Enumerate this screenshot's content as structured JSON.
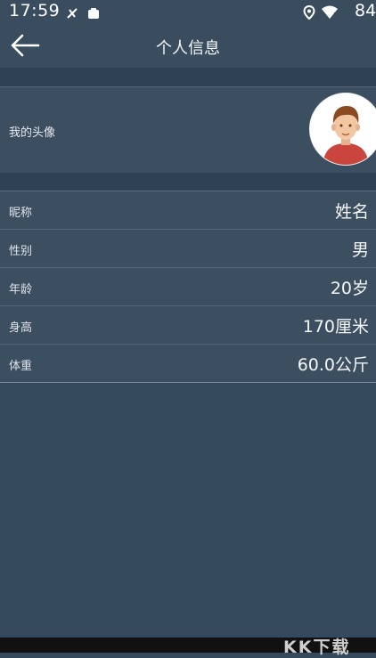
{
  "status_bar": {
    "time": "17:59",
    "battery": "84",
    "icons": [
      "mute-icon",
      "notification-icon",
      "location-icon",
      "wifi-icon"
    ]
  },
  "header": {
    "title": "个人信息",
    "back_icon": "back-arrow-icon"
  },
  "avatar_row": {
    "label": "我的头像"
  },
  "fields": [
    {
      "label": "昵称",
      "value": "姓名"
    },
    {
      "label": "性别",
      "value": "男"
    },
    {
      "label": "年龄",
      "value": "20岁"
    },
    {
      "label": "身高",
      "value": "170厘米"
    },
    {
      "label": "体重",
      "value": "60.0公斤"
    }
  ],
  "watermark": "KK下载",
  "colors": {
    "background": "#34495b",
    "app_bar": "#3a4d5e",
    "row": "#3c4f61"
  }
}
